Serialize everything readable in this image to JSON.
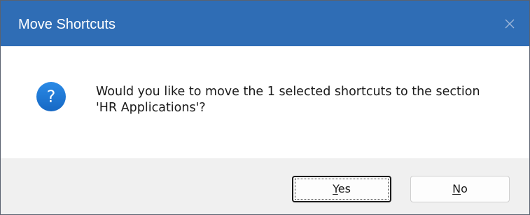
{
  "window": {
    "title": "Move Shortcuts",
    "close_icon": "close-icon",
    "titlebar_color": "#2f6db5"
  },
  "message": {
    "icon": "question-icon",
    "icon_color": "#1e7ad6",
    "text": "Would you like to move the 1 selected shortcuts to the section 'HR Applications'?"
  },
  "buttons": {
    "yes": {
      "accel": "Y",
      "rest": "es",
      "focused": true
    },
    "no": {
      "accel": "N",
      "rest": "o"
    }
  }
}
